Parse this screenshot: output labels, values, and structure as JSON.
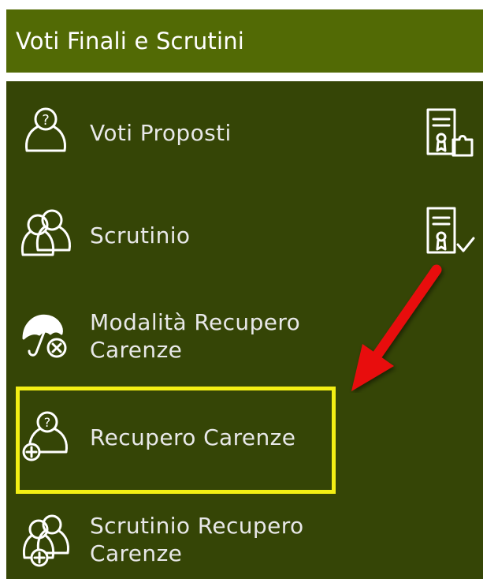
{
  "header": {
    "title": "Voti Finali e Scrutini"
  },
  "menu": {
    "items": [
      {
        "label": "Voti Proposti",
        "icon": "student-question-icon"
      },
      {
        "label": "Scrutinio",
        "icon": "group-students-icon"
      },
      {
        "label": "Modalità Recupero\nCarenze",
        "icon": "umbrella-cancel-icon"
      },
      {
        "label": "Recupero Carenze",
        "icon": "student-question-add-icon"
      },
      {
        "label": "Scrutinio Recupero\nCarenze",
        "icon": "group-students-add-icon"
      }
    ],
    "side_icons": [
      {
        "name": "document-puzzle-icon"
      },
      {
        "name": "document-check-icon"
      }
    ]
  },
  "annotation": {
    "highlight_color": "#f3ef14",
    "arrow_color": "#e8100c"
  },
  "colors": {
    "header_bg": "#526a05",
    "panel_bg": "#354506",
    "text": "#e8e8e8"
  }
}
